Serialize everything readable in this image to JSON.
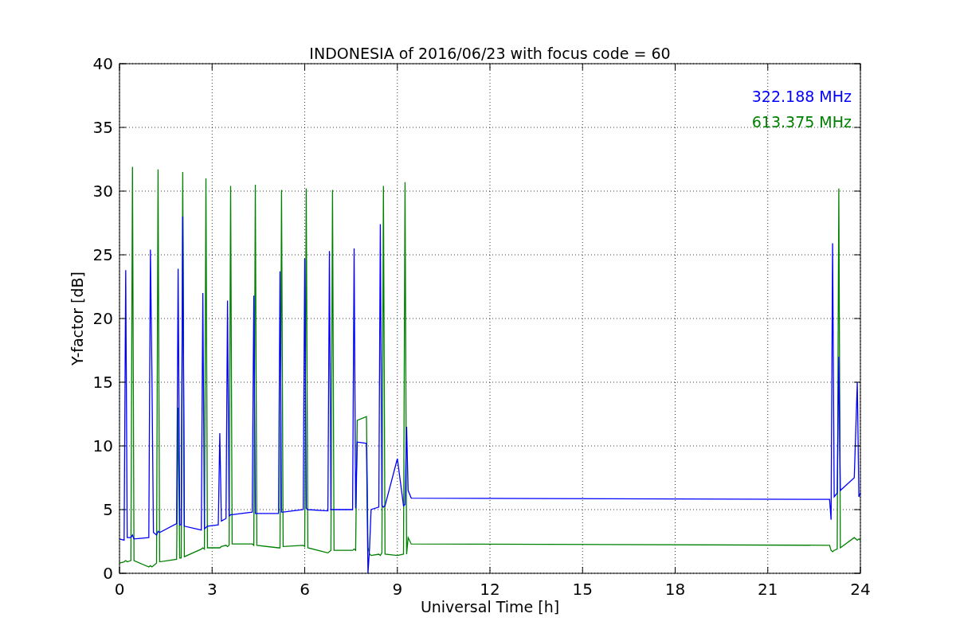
{
  "figure": {
    "chart_data": {
      "type": "line",
      "title": "INDONESIA of 2016/06/23 with focus code = 60",
      "xlabel": "Universal Time [h]",
      "ylabel": "Y-factor [dB]",
      "x": [
        0,
        0.15,
        0.2,
        0.25,
        0.37,
        0.42,
        0.47,
        0.95,
        1.0,
        1.05,
        1.1,
        1.2,
        1.25,
        1.3,
        1.85,
        1.9,
        1.95,
        2.0,
        2.05,
        2.1,
        2.65,
        2.7,
        2.75,
        2.8,
        2.85,
        3.2,
        3.25,
        3.3,
        3.45,
        3.5,
        3.55,
        3.6,
        3.65,
        4.3,
        4.35,
        4.4,
        4.45,
        5.15,
        5.2,
        5.25,
        5.3,
        5.95,
        6.0,
        6.05,
        6.1,
        6.75,
        6.8,
        6.85,
        6.9,
        6.95,
        7.55,
        7.6,
        7.65,
        7.7,
        8.0,
        8.05,
        8.1,
        8.15,
        8.4,
        8.45,
        8.5,
        8.55,
        8.6,
        9.0,
        9.2,
        9.25,
        9.3,
        9.35,
        9.45,
        23.0,
        23.05,
        23.1,
        23.15,
        23.25,
        23.3,
        23.35,
        23.8,
        23.9,
        23.95,
        24
      ],
      "series": [
        {
          "name": "322.188 MHz",
          "color": "#0000ff",
          "values": [
            2.7,
            2.6,
            23.8,
            2.8,
            2.8,
            3,
            2.7,
            2.8,
            25.4,
            15.6,
            3.2,
            3,
            3.3,
            3.2,
            3.9,
            23.9,
            3.8,
            3.8,
            28,
            3.7,
            3.4,
            22,
            3.5,
            3.6,
            3.7,
            3.8,
            11,
            4.1,
            4.3,
            21.4,
            4.5,
            4.6,
            4.6,
            4.8,
            21.8,
            4.7,
            4.7,
            4.7,
            23.7,
            4.8,
            4.8,
            5,
            24.7,
            5.1,
            5,
            4.9,
            25.3,
            5,
            5,
            5,
            5,
            25.5,
            5.1,
            10.3,
            10.2,
            0,
            2,
            5,
            5.2,
            27.4,
            5.3,
            5.2,
            5.3,
            9,
            5.3,
            5.4,
            11.5,
            6.5,
            5.9,
            5.8,
            4.2,
            25.9,
            6,
            6.3,
            17,
            6.5,
            7.5,
            15,
            6,
            6.3
          ]
        },
        {
          "name": "613.375 MHz",
          "color": "#008000",
          "values": [
            0.8,
            0.9,
            1,
            0.9,
            1,
            31.9,
            1,
            0.5,
            0.6,
            0.5,
            0.6,
            0.8,
            31.7,
            0.9,
            1.1,
            13,
            1.2,
            1.2,
            31.5,
            1.3,
            1.9,
            2,
            1.9,
            31,
            2,
            2,
            2,
            2.1,
            2.2,
            2.1,
            2.2,
            30.4,
            2.3,
            2.3,
            2.2,
            30.5,
            2.2,
            2,
            2,
            30.1,
            2.1,
            2.2,
            2.1,
            30.2,
            2,
            1.6,
            1.7,
            1.8,
            30.1,
            1.8,
            1.8,
            1.9,
            1.8,
            12,
            12.3,
            2,
            1.5,
            1.4,
            1.5,
            1.4,
            1.6,
            30.4,
            1.5,
            1.4,
            1.5,
            30.7,
            1.5,
            2.8,
            2.3,
            2.2,
            1.8,
            1.7,
            1.8,
            1.9,
            30.2,
            2,
            2.8,
            2.6,
            2.7,
            2.6
          ]
        }
      ],
      "xlim": [
        0,
        24
      ],
      "ylim": [
        0,
        40
      ],
      "xticks": [
        0,
        3,
        6,
        9,
        12,
        15,
        18,
        21,
        24
      ],
      "yticks": [
        0,
        5,
        10,
        15,
        20,
        25,
        30,
        35,
        40
      ],
      "grid": true
    }
  }
}
